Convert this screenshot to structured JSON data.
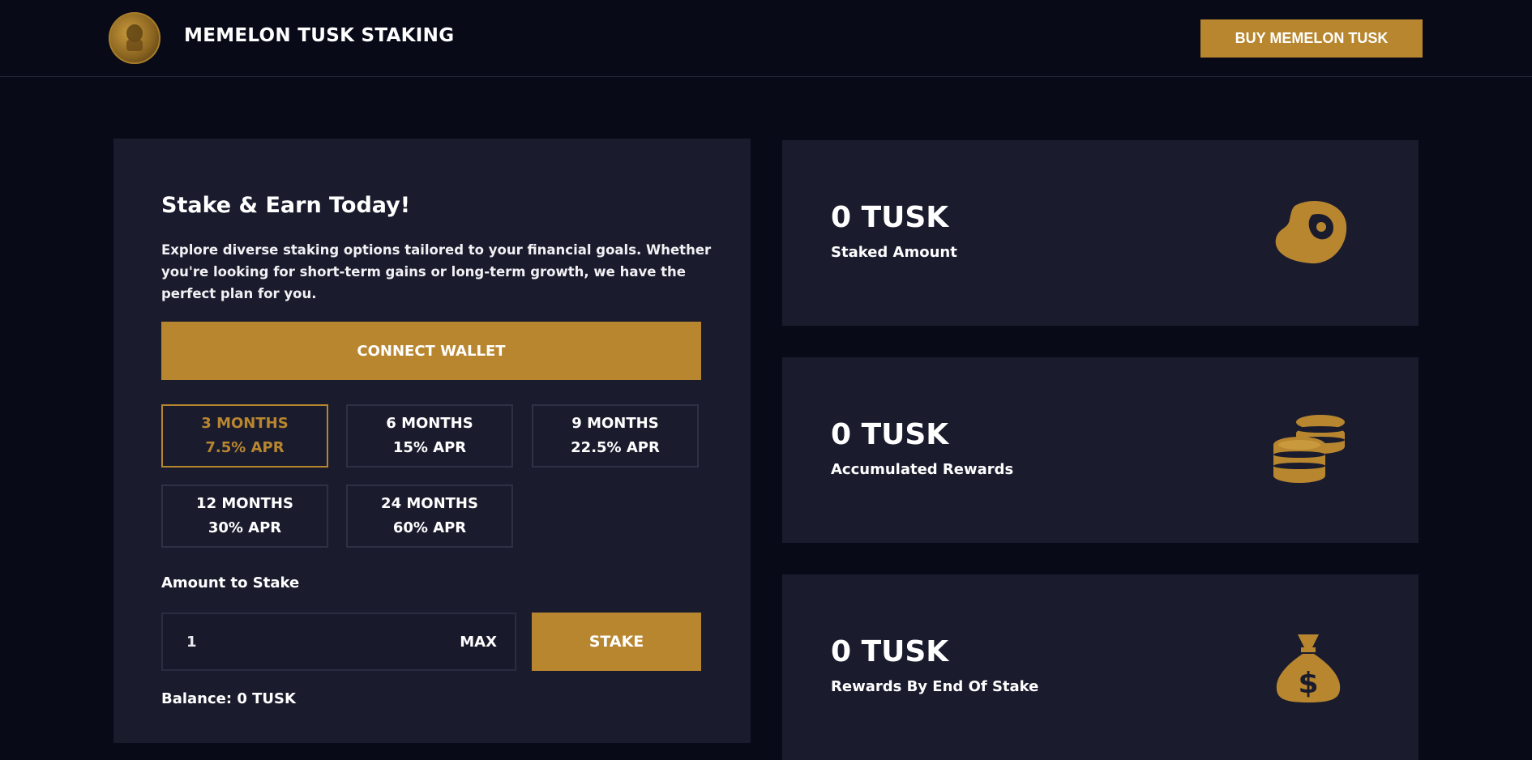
{
  "header": {
    "brand": "MEMELON TUSK STAKING",
    "buy_label": "BUY MEMELON TUSK",
    "logo_icon": "coin-logo-icon"
  },
  "stake": {
    "title": "Stake & Earn Today!",
    "description": "Explore diverse staking options tailored to your financial goals. Whether you're looking for short-term gains or long-term growth, we have the perfect plan for you.",
    "connect_label": "CONNECT WALLET",
    "plans": [
      {
        "duration": "3 MONTHS",
        "apr": "7.5% APR",
        "active": true
      },
      {
        "duration": "6 MONTHS",
        "apr": "15% APR",
        "active": false
      },
      {
        "duration": "9 MONTHS",
        "apr": "22.5% APR",
        "active": false
      },
      {
        "duration": "12 MONTHS",
        "apr": "30% APR",
        "active": false
      },
      {
        "duration": "24 MONTHS",
        "apr": "60% APR",
        "active": false
      }
    ],
    "amount_label": "Amount to Stake",
    "amount_value": "1",
    "max_label": "MAX",
    "stake_label": "STAKE",
    "balance": "Balance: 0 TUSK"
  },
  "stats": [
    {
      "value": "0 TUSK",
      "label": "Staked Amount",
      "icon": "steak-icon"
    },
    {
      "value": "0 TUSK",
      "label": "Accumulated Rewards",
      "icon": "coins-icon"
    },
    {
      "value": "0 TUSK",
      "label": "Rewards By End Of Stake",
      "icon": "money-bag-icon"
    }
  ],
  "colors": {
    "accent": "#b8862e",
    "background": "#080a18",
    "panel": "#1a1c2e"
  }
}
